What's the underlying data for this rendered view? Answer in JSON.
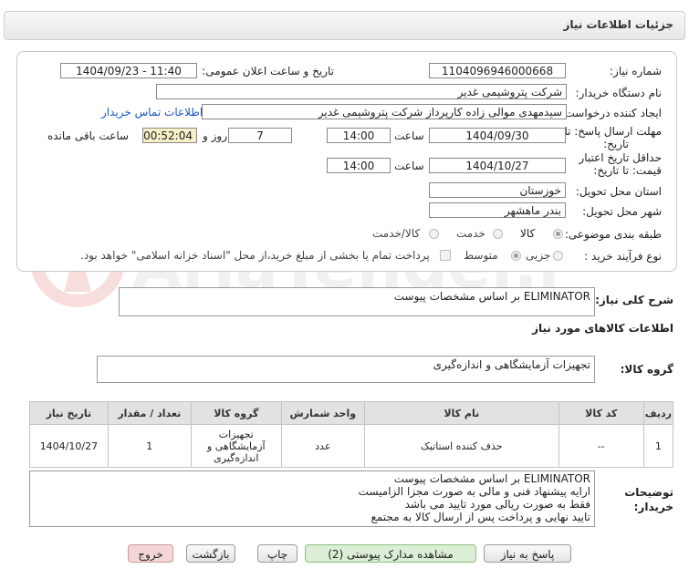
{
  "window": {
    "title": "جزئیات اطلاعات نیاز"
  },
  "form": {
    "need_number_label": "شماره نیاز:",
    "need_number": "1104096946000668",
    "announce_label": "تاریخ و ساعت اعلان عمومی:",
    "announce_value": "1404/09/23 - 11:40",
    "buyer_org_label": "نام دستگاه خریدار:",
    "buyer_org": "شرکت پتروشیمی غدیر",
    "requester_label": "ایجاد کننده درخواست:",
    "requester": "سیدمهدی موالی زاده کارپرداز شرکت پتروشیمی غدیر",
    "contact_link": "اطلاعات تماس خریدار",
    "deadline_label_1": "مهلت ارسال پاسخ: تا",
    "deadline_label_2": "تاریخ:",
    "deadline_date": "1404/09/30",
    "time_label": "ساعت",
    "deadline_time": "14:00",
    "days_value": "7",
    "days_label": "روز و",
    "remaining_value": "00:52:04",
    "remaining_label": "ساعت باقی مانده",
    "validity_label_1": "حداقل تاریخ اعتبار",
    "validity_label_2": "قیمت: تا تاریخ:",
    "validity_date": "1404/10/27",
    "validity_time": "14:00",
    "province_label": "استان محل تحویل:",
    "province": "خوزستان",
    "city_label": "شهر محل تحویل:",
    "city": "بندر ماهشهر",
    "category_label": "طبقه بندی موضوعی:",
    "category_options": [
      "کالا",
      "خدمت",
      "کالا/خدمت"
    ],
    "process_label": "نوع فرآیند خرید :",
    "process_options": [
      "جزیی",
      "متوسط"
    ],
    "payment_note": "پرداخت تمام یا بخشی از مبلغ خرید،از محل \"اسناد خزانه اسلامی\" خواهد بود."
  },
  "summary": {
    "label": "شرح کلی نیاز:",
    "text": "ELIMINATOR بر اساس مشخصات پیوست"
  },
  "goods": {
    "section_title": "اطلاعات کالاهای مورد نیاز",
    "group_label": "گروه کالا:",
    "group_value": "تجهیزات آزمایشگاهی و اندازه‌گیری"
  },
  "table": {
    "headers": [
      "ردیف",
      "کد کالا",
      "نام کالا",
      "واحد شمارش",
      "گروه کالا",
      "تعداد / مقدار",
      "تاریخ نیاز"
    ],
    "rows": [
      {
        "row": "1",
        "code": "--",
        "name": "حذف کننده استاتیک",
        "unit": "عدد",
        "group_1": "تجهیزات",
        "group_2": "آزمایشگاهی و",
        "group_3": "اندازه‌گیری",
        "qty": "1",
        "date": "1404/10/27"
      }
    ]
  },
  "notes": {
    "label_1": "توضیحات",
    "label_2": "خریدار:",
    "lines": [
      "ELIMINATOR بر اساس مشخصات پیوست",
      "ارایه پیشنهاد فنی و مالی به صورت مجزا الزامیست",
      "فقط به صورت ریالی مورد تایید می باشد",
      "تایید نهایی و پرداخت پس از ارسال کالا به مجتمع"
    ]
  },
  "buttons": {
    "reply": "پاسخ به نیاز",
    "docs": "مشاهده مدارک پیوستی (2)",
    "print": "چاپ",
    "back": "بازگشت",
    "exit": "خروج"
  },
  "watermark": {
    "text": "AriaTender.neT"
  },
  "colors": {
    "highlight": "#f6f0c7",
    "link": "#1a56c4",
    "exit_button": "#f5d6d6",
    "docs_button": "#dcefd6"
  }
}
